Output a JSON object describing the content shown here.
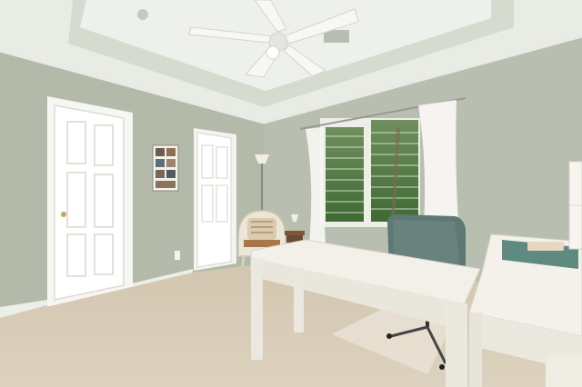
{
  "photo": {
    "subject": "",
    "palette": {
      "wall": "#b6bcaf",
      "wall_shadow": "#a7ae9f",
      "ceiling": "#eceee8",
      "tray": "#d9ddd2",
      "trim": "#f4f4ef",
      "carpet": "#d8ccb7",
      "desk": "#f1efe7",
      "chair": "#5f7a76",
      "window_green": "#4f7a3a",
      "floor_mat": "#e6ddcf"
    }
  }
}
